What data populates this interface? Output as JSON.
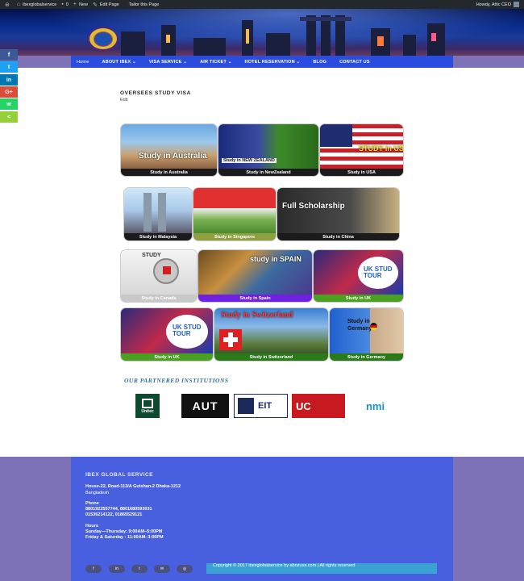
{
  "adminbar": {
    "site": "ibexglobalservice",
    "comments": "0",
    "new": "New",
    "edit_page": "Edit Page",
    "tailor": "Tailor this Page",
    "howdy": "Howdy, Attic CEO"
  },
  "nav": {
    "items": [
      "Home",
      "ABOUT IBEX",
      "VISA SERVICE",
      "AIR TICKET",
      "HOTEL RESERVATION",
      "BLOG",
      "CONTACT US"
    ]
  },
  "share": {
    "items": [
      {
        "label": "f",
        "color": "#3b5998",
        "icon": "facebook-icon"
      },
      {
        "label": "t",
        "color": "#1da1f2",
        "icon": "twitter-icon"
      },
      {
        "label": "in",
        "color": "#0077b5",
        "icon": "linkedin-icon"
      },
      {
        "label": "G+",
        "color": "#dd4b39",
        "icon": "google-plus-icon"
      },
      {
        "label": "w",
        "color": "#25d366",
        "icon": "whatsapp-icon"
      },
      {
        "label": "<",
        "color": "#95d03a",
        "icon": "share-icon"
      }
    ]
  },
  "page": {
    "title": "OVERSEES STUDY VISA",
    "edit": "Edit"
  },
  "tiles": [
    {
      "caption": "Study in Australia",
      "text": "Study in Australia"
    },
    {
      "caption": "Study in NewZealand",
      "text": "Study in NEW ZEALAND"
    },
    {
      "caption": "Study in USA",
      "text": "STUDY in US"
    },
    {
      "caption": "Study in Malaysia",
      "text": ""
    },
    {
      "caption": "Study in Singapore",
      "text": ""
    },
    {
      "caption": "Study in China",
      "text": "Full Scholarship"
    },
    {
      "caption": "Study in Canada",
      "text": "STUDY"
    },
    {
      "caption": "Study in Spain",
      "text": "study in SPAIN"
    },
    {
      "caption": "Study in UK",
      "text": "UK STUD TOUR"
    },
    {
      "caption": "Study in UK",
      "text": "UK STUD TOUR"
    },
    {
      "caption": "Study in Switzerland",
      "text": "Study in Switzerland"
    },
    {
      "caption": "Study in Germany",
      "text": "Study in Germany"
    }
  ],
  "partners": {
    "heading": "OUR PARTNERED INSTITUTIONS",
    "logos": [
      "Unitec",
      "AUT",
      "EIT",
      "UC",
      "nmi"
    ]
  },
  "footer": {
    "brand": "IBEX GLOBAL SERVICE",
    "address1": "House-22, Road-113/A Gulshan-2 Dhaka-1212",
    "address2": "Bangladesh",
    "phone_label": "Phone",
    "phone1": "8801922557744, 8801680593031",
    "phone2": "01536214122, 01865529121",
    "hours_label": "Hours",
    "hours1": "Sunday—Thursday: 9:00AM–5:00PM",
    "hours2": "Friday & Saturday : 11:00AM–3:00PM",
    "copyright": "Copyright © 2017 ibexglobalservice by abnzusa.com | All rights reserved",
    "social": [
      "f",
      "in",
      "t",
      "✉",
      "◎"
    ]
  }
}
